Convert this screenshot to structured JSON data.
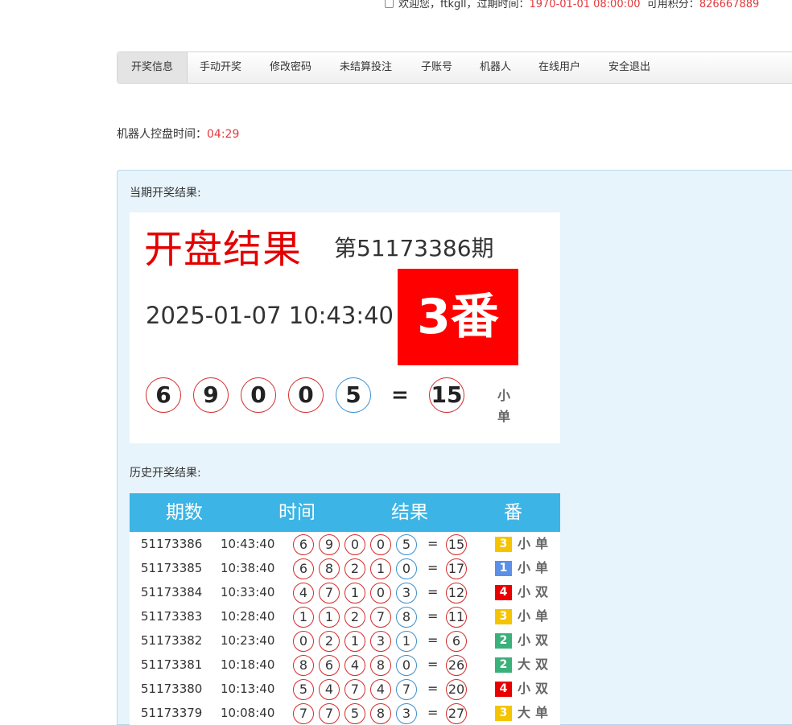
{
  "header": {
    "welcome": "欢迎您，ftkgll，过期时间：",
    "expire": "1970-01-01 08:00:00",
    "credit_label": "可用积分：",
    "credit": "826667889"
  },
  "nav": {
    "items": [
      {
        "label": "开奖信息",
        "active": true
      },
      {
        "label": "手动开奖"
      },
      {
        "label": "修改密码"
      },
      {
        "label": "未结算投注"
      },
      {
        "label": "子账号"
      },
      {
        "label": "机器人"
      },
      {
        "label": "在线用户"
      },
      {
        "label": "安全退出"
      }
    ]
  },
  "robot": {
    "label": "机器人控盘时间：",
    "time": "04:29"
  },
  "current": {
    "section_title": "当期开奖结果:",
    "heading": "开盘结果",
    "period": "第51173386期",
    "datetime": "2025-01-07 10:43:40",
    "fan": "3番",
    "balls": [
      {
        "n": "6",
        "color": "red"
      },
      {
        "n": "9",
        "color": "red"
      },
      {
        "n": "0",
        "color": "red"
      },
      {
        "n": "0",
        "color": "red"
      },
      {
        "n": "5",
        "color": "blue"
      }
    ],
    "eq": "=",
    "sum": "15",
    "tags": "小单"
  },
  "history": {
    "section_title": "历史开奖结果:",
    "headers": [
      "期数",
      "时间",
      "结果",
      "番"
    ],
    "badge_colors": {
      "1": "#5b8fe8",
      "2": "#3ab07a",
      "3": "#f5c400",
      "4": "#e80000"
    },
    "rows": [
      {
        "qs": "51173386",
        "tm": "10:43:40",
        "balls": [
          "6",
          "9",
          "0",
          "0",
          "5"
        ],
        "sum": "15",
        "fan": "3",
        "tags": "小单"
      },
      {
        "qs": "51173385",
        "tm": "10:38:40",
        "balls": [
          "6",
          "8",
          "2",
          "1",
          "0"
        ],
        "sum": "17",
        "fan": "1",
        "tags": "小单"
      },
      {
        "qs": "51173384",
        "tm": "10:33:40",
        "balls": [
          "4",
          "7",
          "1",
          "0",
          "3"
        ],
        "sum": "12",
        "fan": "4",
        "tags": "小双"
      },
      {
        "qs": "51173383",
        "tm": "10:28:40",
        "balls": [
          "1",
          "1",
          "2",
          "7",
          "8"
        ],
        "sum": "11",
        "fan": "3",
        "tags": "小单"
      },
      {
        "qs": "51173382",
        "tm": "10:23:40",
        "balls": [
          "0",
          "2",
          "1",
          "3",
          "1"
        ],
        "sum": "6",
        "fan": "2",
        "tags": "小双"
      },
      {
        "qs": "51173381",
        "tm": "10:18:40",
        "balls": [
          "8",
          "6",
          "4",
          "8",
          "0"
        ],
        "sum": "26",
        "fan": "2",
        "tags": "大双"
      },
      {
        "qs": "51173380",
        "tm": "10:13:40",
        "balls": [
          "5",
          "4",
          "7",
          "4",
          "7"
        ],
        "sum": "20",
        "fan": "4",
        "tags": "小双"
      },
      {
        "qs": "51173379",
        "tm": "10:08:40",
        "balls": [
          "7",
          "7",
          "5",
          "8",
          "3"
        ],
        "sum": "27",
        "fan": "3",
        "tags": "大单"
      }
    ]
  }
}
